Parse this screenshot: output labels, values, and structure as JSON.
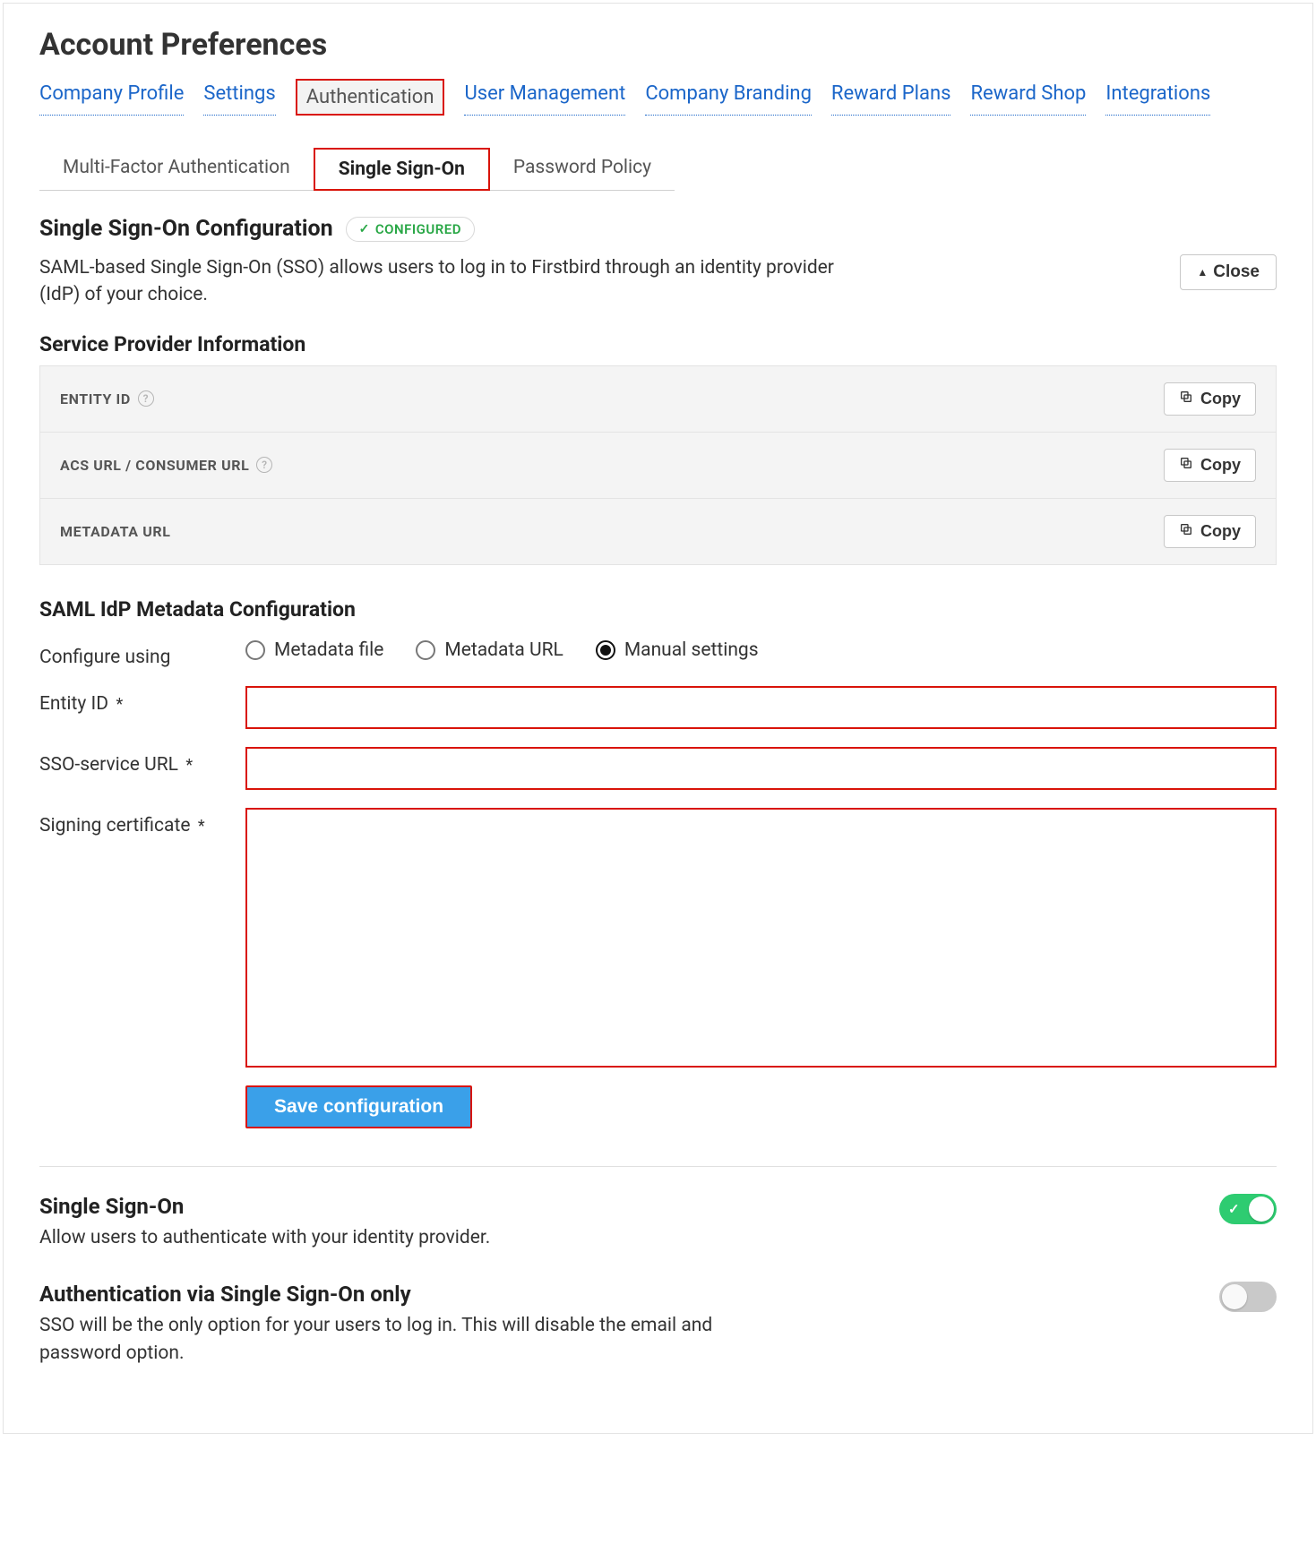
{
  "page_title": "Account Preferences",
  "primary_nav": {
    "items": [
      {
        "label": "Company Profile"
      },
      {
        "label": "Settings"
      },
      {
        "label": "Authentication"
      },
      {
        "label": "User Management"
      },
      {
        "label": "Company Branding"
      },
      {
        "label": "Reward Plans"
      },
      {
        "label": "Reward Shop"
      },
      {
        "label": "Integrations"
      }
    ],
    "active_index": 2
  },
  "sub_nav": {
    "items": [
      {
        "label": "Multi-Factor Authentication"
      },
      {
        "label": "Single Sign-On"
      },
      {
        "label": "Password Policy"
      }
    ],
    "active_index": 1
  },
  "sso_config": {
    "heading": "Single Sign-On Configuration",
    "badge": "CONFIGURED",
    "description": "SAML-based Single Sign-On (SSO) allows users to log in to Firstbird through an identity provider (IdP) of your choice.",
    "close_label": "Close"
  },
  "sp_info": {
    "heading": "Service Provider Information",
    "rows": [
      {
        "label": "ENTITY ID",
        "has_help": true
      },
      {
        "label": "ACS URL / CONSUMER URL",
        "has_help": true
      },
      {
        "label": "METADATA URL",
        "has_help": false
      }
    ],
    "copy_label": "Copy"
  },
  "idp_config": {
    "heading": "SAML IdP Metadata Configuration",
    "configure_using_label": "Configure using",
    "options": [
      {
        "label": "Metadata file"
      },
      {
        "label": "Metadata URL"
      },
      {
        "label": "Manual settings"
      }
    ],
    "selected_option_index": 2,
    "fields": {
      "entity_id": {
        "label": "Entity ID",
        "required": true,
        "value": ""
      },
      "sso_url": {
        "label": "SSO-service URL",
        "required": true,
        "value": ""
      },
      "cert": {
        "label": "Signing certificate",
        "required": true,
        "value": ""
      }
    },
    "save_label": "Save configuration"
  },
  "toggles": {
    "sso": {
      "title": "Single Sign-On",
      "desc": "Allow users to authenticate with your identity provider.",
      "on": true
    },
    "sso_only": {
      "title": "Authentication via Single Sign-On only",
      "desc": "SSO will be the only option for your users to log in. This will disable the email and password option.",
      "on": false
    }
  }
}
